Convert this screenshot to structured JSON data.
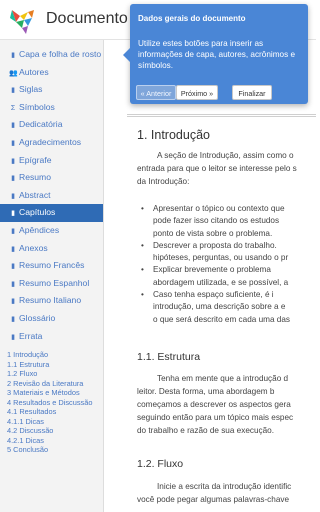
{
  "app": {
    "title": "Documento se"
  },
  "sidebar": {
    "items": [
      {
        "icon": "book-icon",
        "glyph": "▮",
        "label": "Capa e folha de rosto"
      },
      {
        "icon": "users-icon",
        "glyph": "👥",
        "label": "Autores"
      },
      {
        "icon": "list-icon",
        "glyph": "▮",
        "label": "Siglas"
      },
      {
        "icon": "sigma-icon",
        "glyph": "Σ",
        "label": "Símbolos"
      },
      {
        "icon": "file-icon",
        "glyph": "▮",
        "label": "Dedicatória"
      },
      {
        "icon": "file-icon",
        "glyph": "▮",
        "label": "Agradecimentos"
      },
      {
        "icon": "file-icon",
        "glyph": "▮",
        "label": "Epígrafe"
      },
      {
        "icon": "file-icon",
        "glyph": "▮",
        "label": "Resumo"
      },
      {
        "icon": "file-icon",
        "glyph": "▮",
        "label": "Abstract"
      },
      {
        "icon": "file-icon",
        "glyph": "▮",
        "label": "Capítulos",
        "active": true
      },
      {
        "icon": "file-icon",
        "glyph": "▮",
        "label": "Apêndices"
      },
      {
        "icon": "file-icon",
        "glyph": "▮",
        "label": "Anexos"
      },
      {
        "icon": "file-icon",
        "glyph": "▮",
        "label": "Resumo Francês"
      },
      {
        "icon": "file-icon",
        "glyph": "▮",
        "label": "Resumo Espanhol"
      },
      {
        "icon": "file-icon",
        "glyph": "▮",
        "label": "Resumo Italiano"
      },
      {
        "icon": "file-icon",
        "glyph": "▮",
        "label": "Glossário"
      },
      {
        "icon": "file-icon",
        "glyph": "▮",
        "label": "Errata"
      }
    ],
    "toc": [
      "1 Introdução",
      "1.1 Estrutura",
      "1.2 Fluxo",
      "2 Revisão da Literatura",
      "3 Materiais e Métodos",
      "4 Resultados e Discussão",
      "4.1 Resultados",
      "4.1.1 Dicas",
      "4.2 Discussão",
      "4.2.1 Dicas",
      "5 Conclusão"
    ]
  },
  "popover": {
    "title": "Dados gerais do documento",
    "body": "Utilize estes botões para inserir as informações de capa, autores, acrônimos e símbolos.",
    "prev_label": "« Anterior",
    "next_label": "Próximo »",
    "finish_label": "Finalizar"
  },
  "document": {
    "heading1": "1. Introdução",
    "intro_lines": [
      "A seção de Introdução, assim como o",
      "entrada para que o leitor se interesse pelo s",
      "da Introdução:"
    ],
    "bullets": [
      [
        "Apresentar o tópico ou contexto que",
        "pode fazer isso citando os estudos",
        "ponto de vista sobre o problema."
      ],
      [
        "Descrever a proposta do trabalho.",
        "hipóteses, perguntas, ou usando o pr"
      ],
      [
        "Explicar brevemente o problema",
        "abordagem utilizada, e se possível, a"
      ],
      [
        "Caso tenha espaço suficiente, é i",
        "introdução, uma descrição sobre a e",
        "o que será descrito em cada uma das"
      ]
    ],
    "heading_estrutura": "1.1. Estrutura",
    "estrutura_lines": [
      "Tenha em mente que a introdução d",
      "leitor. Desta forma, uma abordagem b",
      "começamos a descrever os aspectos gera",
      "seguindo então para um tópico mais espec",
      "do trabalho e razão de sua execução."
    ],
    "heading_fluxo": "1.2. Fluxo",
    "fluxo_lines": [
      "Inicie a escrita da introdução identific",
      "você pode pegar algumas palavras-chave"
    ]
  }
}
